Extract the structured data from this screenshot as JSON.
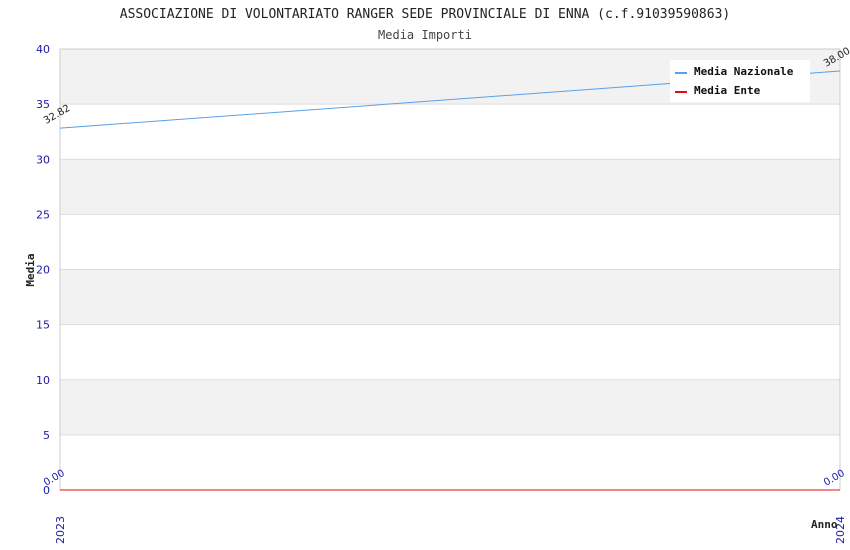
{
  "chart_data": {
    "type": "line",
    "title": "ASSOCIAZIONE DI VOLONTARIATO RANGER SEDE PROVINCIALE DI ENNA (c.f.91039590863)",
    "subtitle": "Media Importi",
    "xlabel": "Anno",
    "ylabel": "Media",
    "ylim": [
      0,
      40
    ],
    "yticks": [
      "0",
      "5",
      "10",
      "15",
      "20",
      "25",
      "30",
      "35",
      "40"
    ],
    "categories": [
      "2023",
      "2024"
    ],
    "grid": true,
    "legend_position": "top-right",
    "series": [
      {
        "name": "Media Nazionale",
        "color": "#5aa0e8",
        "values": [
          32.82,
          38.0
        ],
        "labels": [
          "32.82",
          "38.00"
        ]
      },
      {
        "name": "Media Ente",
        "color": "#e01010",
        "values": [
          0,
          0
        ],
        "labels": [
          "0.00",
          "0.00"
        ]
      }
    ]
  }
}
